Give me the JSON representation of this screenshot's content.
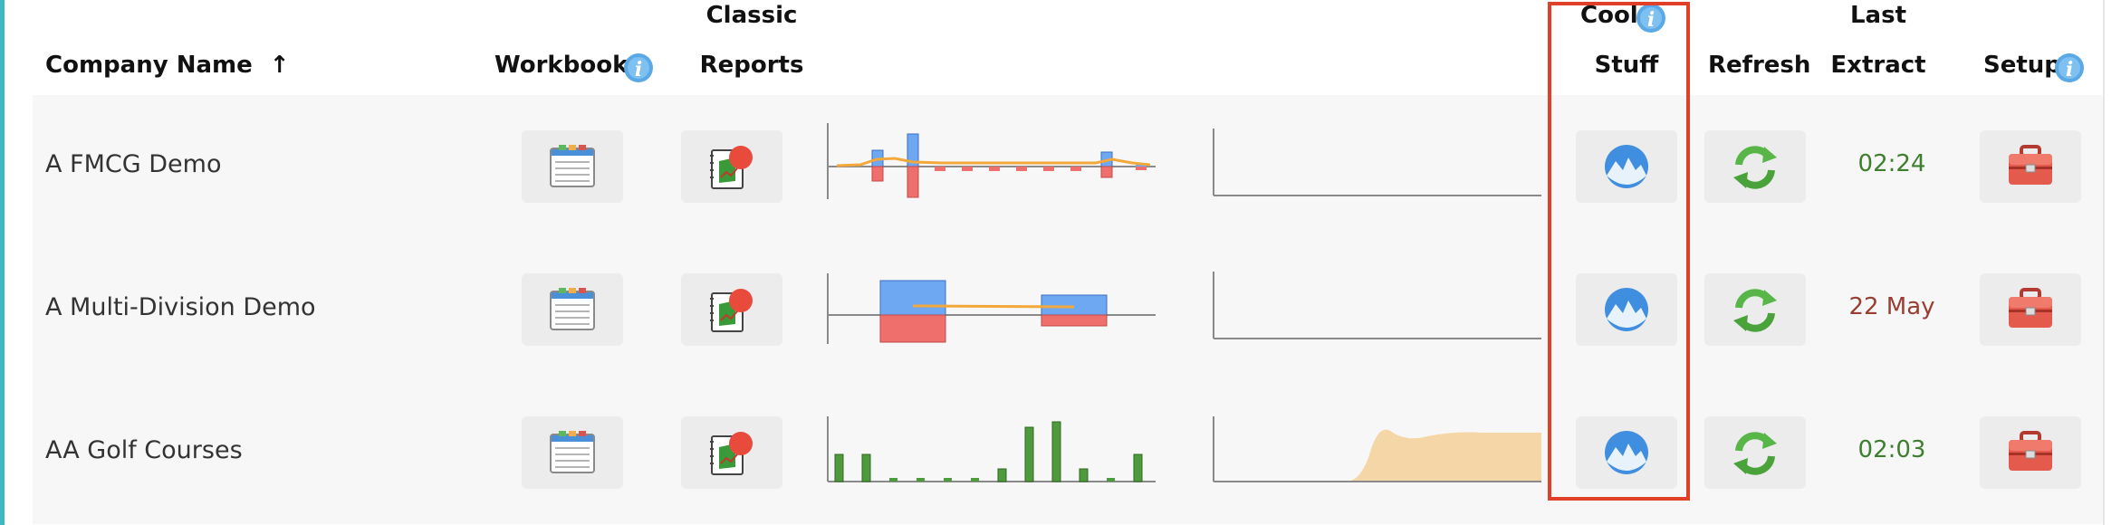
{
  "columns": {
    "company_name": "Company Name",
    "sort_arrow": "↑",
    "workbooks": "Workbooks",
    "classic_line1": "Classic",
    "classic_line2": "Reports",
    "cool_line1": "Cool",
    "cool_line2": "Stuff",
    "refresh": "Refresh",
    "last_line1": "Last",
    "last_line2": "Extract",
    "setup": "Setup"
  },
  "rows": [
    {
      "company": "A FMCG Demo",
      "last_extract": "02:24",
      "status_color": "#3d7f2e"
    },
    {
      "company": "A Multi-Division Demo",
      "last_extract": "22 May",
      "status_color": "#9a3e34"
    },
    {
      "company": "AA Golf Courses",
      "last_extract": "02:03",
      "status_color": "#3d7f2e"
    }
  ],
  "colors": {
    "accent": "#3fb9bf",
    "highlight": "#e04028",
    "bar_positive": "#6ea7f2",
    "bar_negative": "#ef6f6c",
    "trend_line": "#f2a83a",
    "bar_green": "#4f9a3c",
    "area_fill": "#f5d6a6"
  },
  "icons": {
    "info": "info-icon",
    "workbook": "workbook-icon",
    "report": "report-icon",
    "cool": "mountain-logo-icon",
    "refresh": "refresh-icon",
    "setup": "toolbox-icon"
  }
}
